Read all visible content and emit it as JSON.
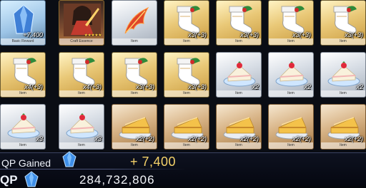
{
  "items": {
    "row0": [
      {
        "name": "saint-quartz-item",
        "frame": "blue",
        "label": "Basic Reward",
        "count": "+7,400",
        "icon": "qp-crystal"
      },
      {
        "name": "craft-essence-item",
        "frame": "dark",
        "label": "Craft Essence",
        "stars": "★★★★★",
        "icon": "craft-essence-portrait"
      },
      {
        "name": "phoenix-feather-item",
        "frame": "silver",
        "label": "Item",
        "icon": "phoenix-feather"
      },
      {
        "name": "stocking-item-1",
        "frame": "gold",
        "label": "Item",
        "count": "x3(+3)",
        "icon": "christmas-stocking"
      },
      {
        "name": "stocking-item-2",
        "frame": "gold",
        "label": "Item",
        "count": "x3(+3)",
        "icon": "christmas-stocking"
      },
      {
        "name": "stocking-item-3",
        "frame": "gold",
        "label": "Item",
        "count": "x3(+3)",
        "icon": "christmas-stocking"
      },
      {
        "name": "stocking-item-4",
        "frame": "gold",
        "label": "Item",
        "count": "x3(+3)",
        "icon": "christmas-stocking"
      }
    ],
    "row1": [
      {
        "name": "stocking-item-5",
        "frame": "gold",
        "label": "Item",
        "count": "x4(+3)",
        "icon": "christmas-stocking"
      },
      {
        "name": "stocking-item-6",
        "frame": "gold",
        "label": "Item",
        "count": "x4(+3)",
        "icon": "christmas-stocking"
      },
      {
        "name": "stocking-item-7",
        "frame": "gold",
        "label": "Item",
        "count": "x3(+3)",
        "icon": "christmas-stocking"
      },
      {
        "name": "stocking-item-8",
        "frame": "gold",
        "label": "Item",
        "count": "x3(+3)",
        "icon": "christmas-stocking"
      },
      {
        "name": "strawberry-cake-item-1",
        "frame": "silver",
        "label": "Item",
        "count": "x2",
        "icon": "strawberry-cake"
      },
      {
        "name": "strawberry-cake-item-2",
        "frame": "silver",
        "label": "Item",
        "count": "x2",
        "icon": "strawberry-cake"
      },
      {
        "name": "strawberry-cake-item-3",
        "frame": "silver",
        "label": "Item",
        "count": "x2",
        "icon": "strawberry-cake"
      }
    ],
    "row2": [
      {
        "name": "strawberry-cake-item-4",
        "frame": "silver",
        "label": "Item",
        "count": "x3",
        "icon": "strawberry-cake"
      },
      {
        "name": "strawberry-cake-item-5",
        "frame": "silver",
        "label": "Item",
        "count": "x3",
        "icon": "strawberry-cake"
      },
      {
        "name": "cheesecake-item-1",
        "frame": "bronze",
        "label": "Item",
        "count": "x2(+2)",
        "icon": "cheesecake"
      },
      {
        "name": "cheesecake-item-2",
        "frame": "bronze",
        "label": "Item",
        "count": "x2(+2)",
        "icon": "cheesecake"
      },
      {
        "name": "cheesecake-item-3",
        "frame": "bronze",
        "label": "Item",
        "count": "x2(+2)",
        "icon": "cheesecake"
      },
      {
        "name": "cheesecake-item-4",
        "frame": "bronze",
        "label": "Item",
        "count": "x2(+2)",
        "icon": "cheesecake"
      },
      {
        "name": "cheesecake-item-5",
        "frame": "bronze",
        "label": "Item",
        "count": "x2(+2)",
        "icon": "cheesecake"
      }
    ]
  },
  "footer": {
    "qp_gained_label": "QP Gained",
    "qp_gained_value": "+ 7,400",
    "qp_label": "QP",
    "qp_total": "284,732,806"
  },
  "colors": {
    "gained_value": "#f5d26a",
    "background": "#05070c"
  }
}
